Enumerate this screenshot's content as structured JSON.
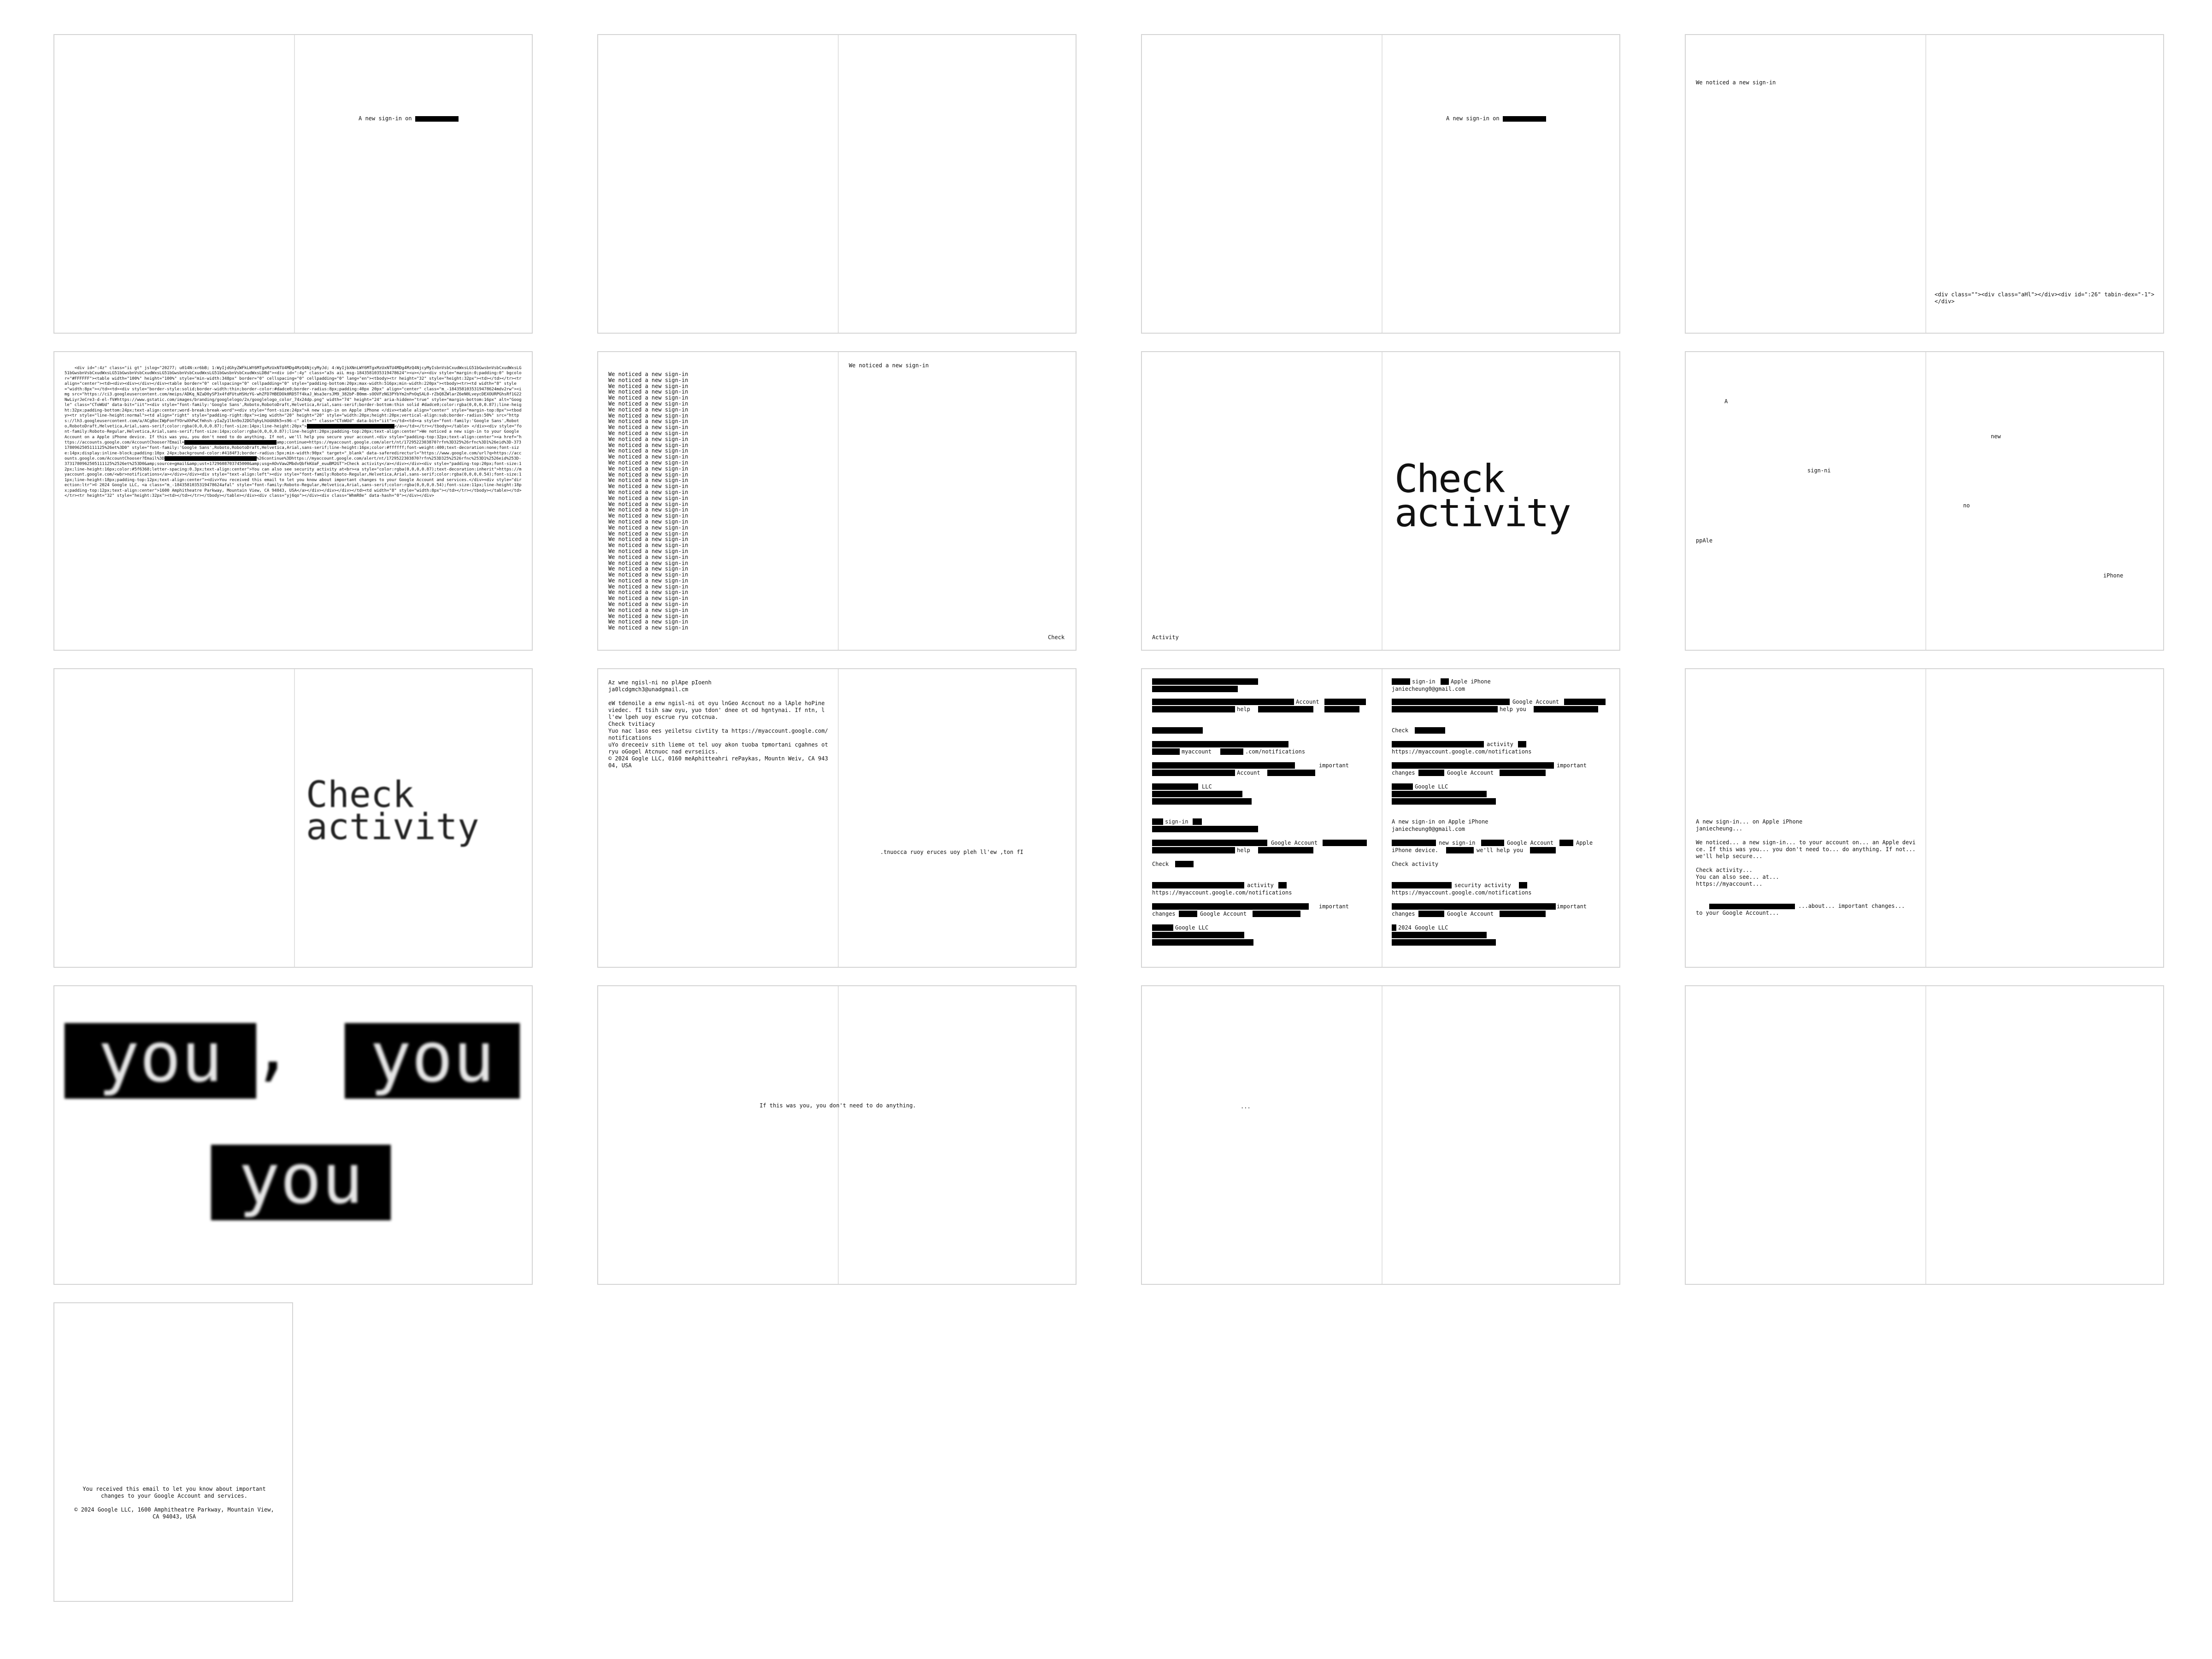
{
  "p1": {
    "text": "A new sign-in on"
  },
  "p3": {
    "text": "A new sign-in on"
  },
  "p4": {
    "top": "We noticed a new sign-in",
    "code": "<div class=\"\"><div class=\"aHl\"></div><div id=\":26\" tabin-dex=\"-1\"></div>"
  },
  "p5": {
    "code": "<div id=\":4z\" class=\"ii gt\" jslog=\"20277; u014N:xr6bB; 1:WyIjdGhyZWFkLWY6MTgxMzUxNTU4MDg4MzQ4NjcyMyJd; 4:WyIjbXNnLWY6MTgxMzUxNTU4MDg4MzQ4NjcyMyIsbnVsbCxudWxsLG51bGwsbnVsbCxudWxsLG51bGwsbnVsbCxudWxsLG51bGwsbnVsbCxudWxsLG51bGwsbnVsbCxudWxsLG51bGwsbnVsbCxudWxsLDBd\"><div id=\":4y\" class=\"a3s aiL msg-1843581035319478624\"><u></u><div style=\"margin:0;padding:0\" bgcolor=\"#FFFFFF\"><table width=\"100%\" height=\"100%\" style=\"min-width:348px\" border=\"0\" cellspacing=\"0\" cellpadding=\"0\" lang=\"en\"><tbody><tr height=\"32\" style=\"height:32px\"><td></td></tr><tr align=\"center\"><td><div><div></div></div><table border=\"0\" cellspacing=\"0\" cellpadding=\"0\" style=\"padding-bottom:20px;max-width:516px;min-width:220px\"><tbody><tr><td width=\"8\" style=\"width:8px\"></td><td><div style=\"border-style:solid;border-width:thin;border-color:#dadce0;border-radius:8px;padding:40px 20px\" align=\"center\" class=\"m_-1843581035319478624mdv2rw\"><img src=\"https://ci3.googleusercontent.com/meips/ADKq_NZaD0ySP3x4fdFUtuHSHzYG-whZFD7HBEDOk0RD5Tf4kaJ_Wsa3ersJM9_382bP-B0mm-sOOVFzNG3PYbYm2nPnOqSAL0-rZbQ8ZWlarZ6eN0LveycDEXOURPGhsRf1G22NwLiyrJeCre3-d-el-fV#https://www.gstatic.com/images/branding/googlelogo/2x/googlelogo_color_74x24dp.png\" width=\"74\" height=\"24\" aria-hidden=\"true\" style=\"margin-bottom:16px\" alt=\"Google\" class=\"CToWUd\" data-bit=\"iit\"><div style=\"font-family:'Google Sans',Roboto,RobotoDraft,Helvetica,Arial,sans-serif;border-bottom:thin solid #dadce0;color:rgba(0,0,0,0.87);line-height:32px;padding-bottom:24px;text-align:center;word-break:break-word\"><div style=\"font-size:24px\">A new sign-in on Apple iPhone </div><table align=\"center\" style=\"margin-top:8px\"><tbody><tr style=\"line-height:normal\"><td align=\"right\" style=\"padding-right:8px\"><img width=\"20\" height=\"20\" style=\"width:20px;height:20px;vertical-align:sub;border-radius:50%\" src=\"https://lh3.googleusercontent.com/a/ACg8ocIWpFonfYOrwXhPwCfmhsh-yIaZy1lkn9oJ2DGTqhyLhUdA8k5=s96-c\" alt=\"\" class=\"CToWUd\" data-bit=\"iit\"></td><td><a style=\"font-family:'Google Sans',Roboto,RobotoDraft,Helvetica,Arial,sans-serif;color:rgba(0,0,0,0.87);font-size:14px;line-height:20px\">",
    "code2": "</a></td></tr></tbody></table> </div><div style=\"font-family:Roboto-Regular,Helvetica,Arial,sans-serif;font-size:14px;color:rgba(0,0,0,0.87);line-height:20px;padding-top:20px;text-align:center\">We noticed a new sign-in to your Google Account on a Apple iPhone device. If this was you, you don't need to do anything. If not, we'll help you secure your account.<div style=\"padding-top:32px;text-align:center\"><a href=\"https://accounts.google.com/AccountChooser?Email=",
    "code3": "amp;continue=https://myaccount.google.com/alert/nt/1729522303870?rfn%3D325%26rfnc%3D1%26eid%3D-3731780962505111125%26et%3D0\" style=\"font-family:'Google Sans',Roboto,RobotoDraft,Helvetica,Arial,sans-serif;line-height:16px;color:#ffffff;font-weight:400;text-decoration:none;font-size:14px;display:inline-block;padding:10px 24px;background-color:#4184F3;border-radius:5px;min-width:90px\" target=\"_blank\" data-saferedirecturl=\"https://www.google.com/url?q=https://accounts.google.com/AccountChooser?Email%3D",
    "code4": "%26continue%3Dhttps://myaccount.google.com/alert/nt/1729522303870?rfn%253D325%2526rfnc%253D1%2526eid%253D-3731780962505111125%2526et%253D0&amp;source=gmail&amp;ust=1729608703745000&amp;usg=AOvVaw2MbdvQbfkKUaF_euuBM2GT\">Check activity</a></div></div><div style=\"padding-top:20px;font-size:12px;line-height:16px;color:#5f6368;letter-spacing:0.3px;text-align:center\">You can also see security activity at<br><a style=\"color:rgba(0,0,0,0.87);text-decoration:inherit\">https://myaccount.google.com/<wbr>notifications</a></div></div><div style=\"text-align:left\"><div style=\"font-family:Roboto-Regular,Helvetica,Arial,sans-serif;color:rgba(0,0,0,0.54);font-size:11px;line-height:18px;padding-top:12px;text-align:center\"><div>You received this email to let you know about important changes to your Google Account and services.</div><div style=\"direction:ltr\">© 2024 Google LLC, <a class=\"m_-1843581035319478624afal\" style=\"font-family:Roboto-Regular,Helvetica,Arial,sans-serif;color:rgba(0,0,0,0.54);font-size:11px;line-height:18px;padding-top:12px;text-align:center\">1600 Amphitheatre Parkway, Mountain View, CA 94043, USA</a></div></div></div></td><td width=\"8\" style=\"width:8px\"></td></tr></tbody></table></td></tr><tr height=\"32\" style=\"height:32px\"><td></td></tr></tbody></table></div><div class=\"yj6qo\"></div><div class=\"WhmR8e\" data-hash=\"0\"></div></div>"
  },
  "p6": {
    "header": "We noticed a new sign-in",
    "line": "We noticed a new sign-in",
    "footer": "Check"
  },
  "p7": {
    "line1": "Check",
    "line2": "activity",
    "footer": "Activity"
  },
  "p8": {
    "w1": "A",
    "w2": "new",
    "w3": "sign-ni",
    "w4": "no",
    "w5": "ppAle",
    "w6": "iPhone"
  },
  "p9": {
    "line1": "Check",
    "line2": "activity"
  },
  "p10": {
    "left": "Az wne ngisl-ni no plApe pIoenh\nja0lcdgmch3@unadgmail.cm\n\neW tdenoile a enw ngisl-ni ot oyu lnGeo Accnout no a lAple hoPine viedec. fI tsih saw oyu, yuo tdon' dnee ot od hgntynai. If ntn, ll'ew lpeh uoy escrue ryu cotcnua.\nCheck tvitiacy\nYuo nac laso ees yeiletsu civtity ta https://myaccount.google.com/notifications\nuYo dreceeiv sith lieme ot tel uoy akon tuoba tpmortani cgahnes ot ryu oGogel Atcnuoc nad evrseiics.\n© 2024 Gogle LLC, 0160 meAphitteahri rePaykas, Mountn Weiv, CA 94304, USA",
    "right": ".tnuocca ruoy eruces uoy pleh ll'ew ,ton fI"
  },
  "p11": {
    "l_signin": "sign-in",
    "l_account": "Account",
    "l_help": "help",
    "l_myaccount": "myaccount",
    "l_notifications": ".com/notifications",
    "l_important": "important",
    "l_account2": "Account",
    "l_llc": "LLC",
    "l_signin2": "sign-in",
    "l_google_account": "Google Account",
    "l_help2": "help",
    "l_check": "Check",
    "l_activity": "activity",
    "l_url": "https://myaccount.google.com/notifications",
    "l_important2": "important",
    "l_changes": "changes",
    "l_google_account2": "Google Account",
    "l_google_llc": "Google LLC",
    "r_signin": "sign-in",
    "r_apple": "Apple iPhone",
    "r_email": "janiecheung0@gmail.com",
    "r_google_account": "Google Account",
    "r_help_you": "help you",
    "r_check": "Check",
    "r_activity": "activity",
    "r_url": "https://myaccount.google.com/notifications",
    "r_important": "important",
    "r_changes": "changes",
    "r_google_account2": "Google Account",
    "r_google_llc": "Google LLC",
    "r2_title": "A new sign-in on Apple iPhone",
    "r2_email": "janiecheung0@gmail.com",
    "r2_new_signin": "new sign-in",
    "r2_google_account": "Google Account",
    "r2_apple": "Apple",
    "r2_iphone_device": "iPhone device.",
    "r2_help": "we'll help you",
    "r2_check": "Check activity",
    "r2_security": "security activity",
    "r2_url": "https://myaccount.google.com/notifications",
    "r2_important": "important",
    "r2_changes": "changes",
    "r2_google_account2": "Google Account",
    "r2_llc": "2024 Google LLC"
  },
  "p12": {
    "text": "A new sign-in... on Apple iPhone\njaniecheung...\n\nWe noticed... a new sign-in... to your account on... an Apple device. If this was you... you don't need to... do anything. If not... we'll help secure...\n\nCheck activity...\nYou can also see... at...\nhttps://myaccount...",
    "tail": "...about... important changes...\nto your Google Account..."
  },
  "p13": {
    "word1": "you",
    "comma": ",",
    "word2": "you",
    "word3": "you"
  },
  "p14": {
    "text": "If this was you, you don't need to do anything."
  },
  "p15": {
    "text": "..."
  },
  "p17": {
    "line1": "You received this email to let you know about important changes to your Google Account and services.",
    "line2": "© 2024 Google LLC, 1600 Amphitheatre Parkway, Mountain View, CA 94043, USA"
  }
}
